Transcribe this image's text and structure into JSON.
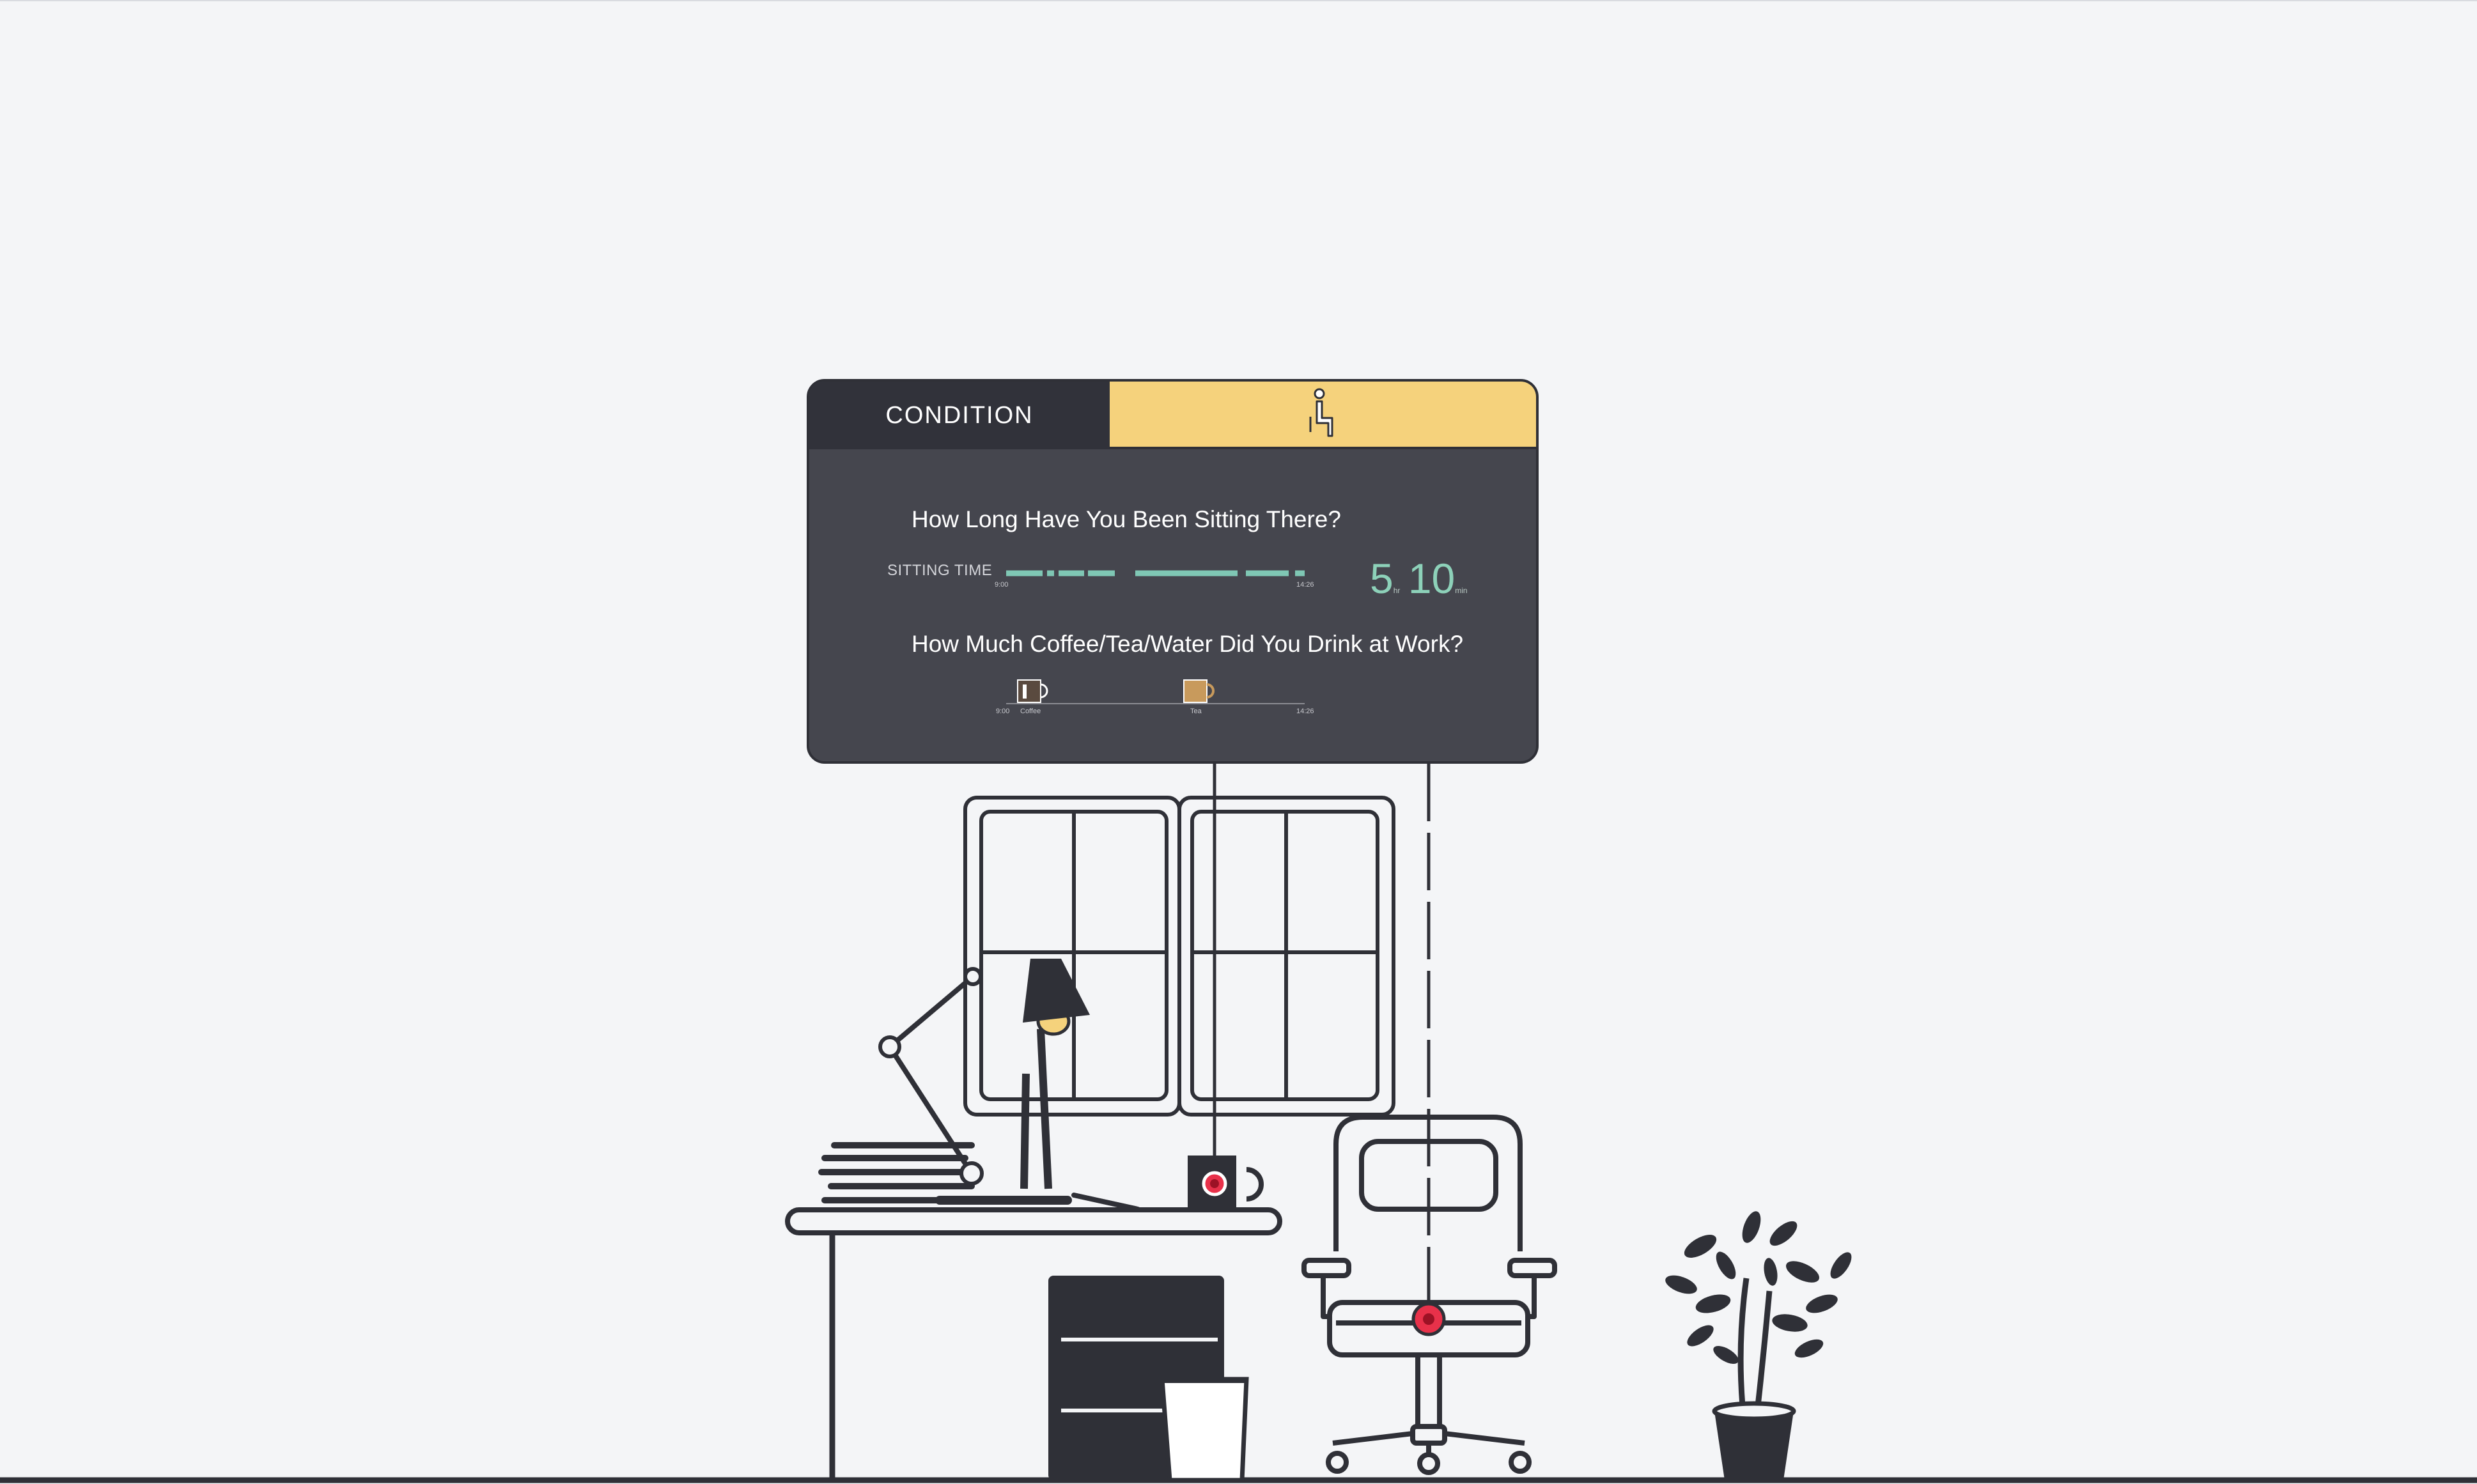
{
  "panel": {
    "tab_condition": "CONDITION",
    "tab_sitting_icon": "person-sitting-icon",
    "question_sitting": "How Long Have You Been Sitting There?",
    "sitting_label": "SITTING TIME",
    "sitting_hours": "5",
    "sitting_hours_unit": "hr",
    "sitting_minutes": "10",
    "sitting_minutes_unit": "min",
    "sitting_start": "9:00",
    "sitting_end": "14:26",
    "question_drinks": "How Much Coffee/Tea/Water Did You Drink at Work?",
    "drinks_start": "9:00",
    "drinks_end": "14:26",
    "drinks": [
      {
        "label": "Coffee",
        "icon": "coffee-mug-icon",
        "color": "#5a4a3f"
      },
      {
        "label": "Tea",
        "icon": "tea-mug-icon",
        "color": "#c89a5c"
      }
    ]
  },
  "colors": {
    "accent_yellow": "#f5d27c",
    "panel_bg": "#45464e",
    "tab_dark": "#31323a",
    "sitting_bar": "#7fc7b4",
    "sensor_red": "#e8314a",
    "outline": "#2f3037"
  },
  "scene_icons": [
    "window-icon",
    "desk-lamp-icon",
    "book-stack-icon",
    "mug-sensor-icon",
    "desk-icon",
    "drawer-cabinet-icon",
    "trash-bin-icon",
    "office-chair-icon",
    "chair-sensor-icon",
    "potted-plant-icon"
  ]
}
